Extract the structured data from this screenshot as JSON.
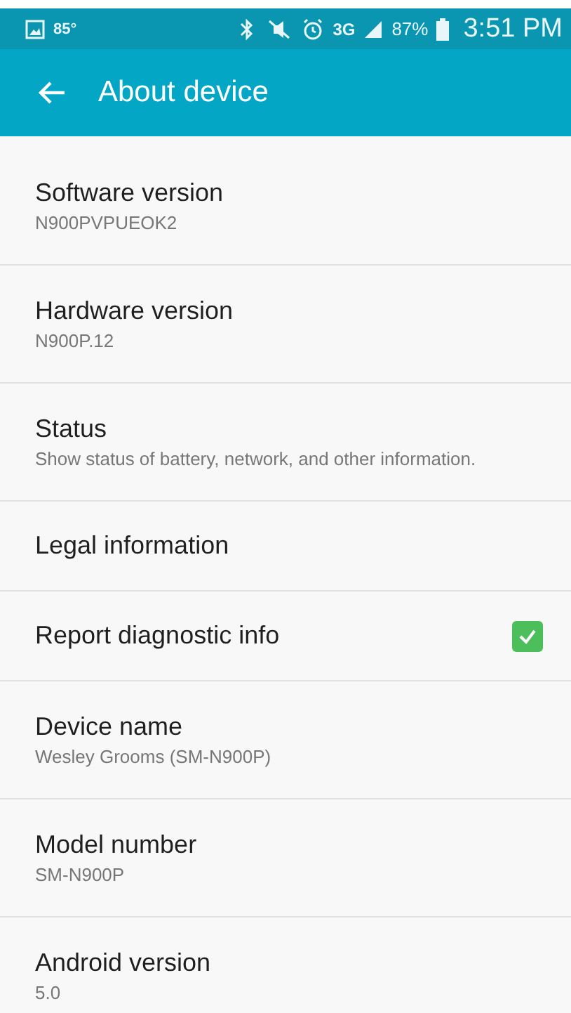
{
  "status_bar": {
    "temperature": "85°",
    "network": "3G",
    "battery": "87%",
    "time": "3:51 PM"
  },
  "toolbar": {
    "title": "About device"
  },
  "items": [
    {
      "kind": "text",
      "title": "Software version",
      "summary": "N900PVPUEOK2"
    },
    {
      "kind": "text",
      "title": "Hardware version",
      "summary": "N900P.12"
    },
    {
      "kind": "text",
      "title": "Status",
      "summary": "Show status of battery, network, and other information."
    },
    {
      "kind": "text",
      "title": "Legal information"
    },
    {
      "kind": "checkbox",
      "title": "Report diagnostic info",
      "checked": true
    },
    {
      "kind": "text",
      "title": "Device name",
      "summary": "Wesley Grooms (SM-N900P)"
    },
    {
      "kind": "text",
      "title": "Model number",
      "summary": "SM-N900P"
    },
    {
      "kind": "text",
      "title": "Android version",
      "summary": "5.0"
    }
  ]
}
